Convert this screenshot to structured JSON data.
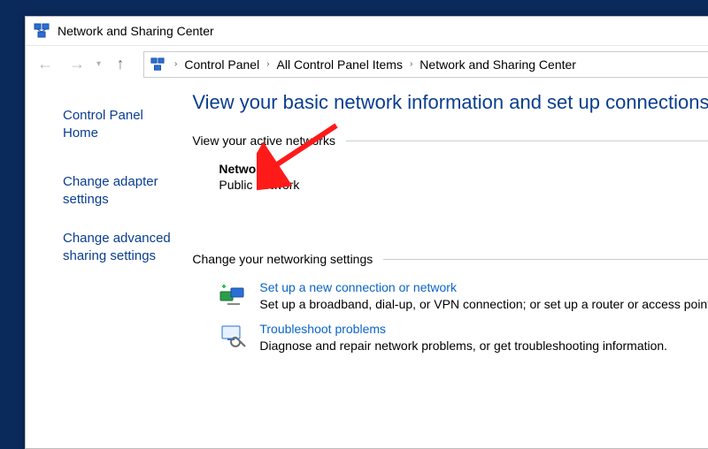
{
  "window": {
    "title": "Network and Sharing Center"
  },
  "breadcrumbs": {
    "item0": "Control Panel",
    "item1": "All Control Panel Items",
    "item2": "Network and Sharing Center"
  },
  "sidebar": {
    "home": "Control Panel Home",
    "link_adapter": "Change adapter settings",
    "link_advanced": "Change advanced sharing settings"
  },
  "main": {
    "heading": "View your basic network information and set up connections",
    "active_header": "View your active networks",
    "network_name": "Network",
    "network_type": "Public network",
    "change_header": "Change your networking settings",
    "option1_title": "Set up a new connection or network",
    "option1_desc": "Set up a broadband, dial-up, or VPN connection; or set up a router or access point.",
    "option2_title": "Troubleshoot problems",
    "option2_desc": "Diagnose and repair network problems, or get troubleshooting information."
  }
}
